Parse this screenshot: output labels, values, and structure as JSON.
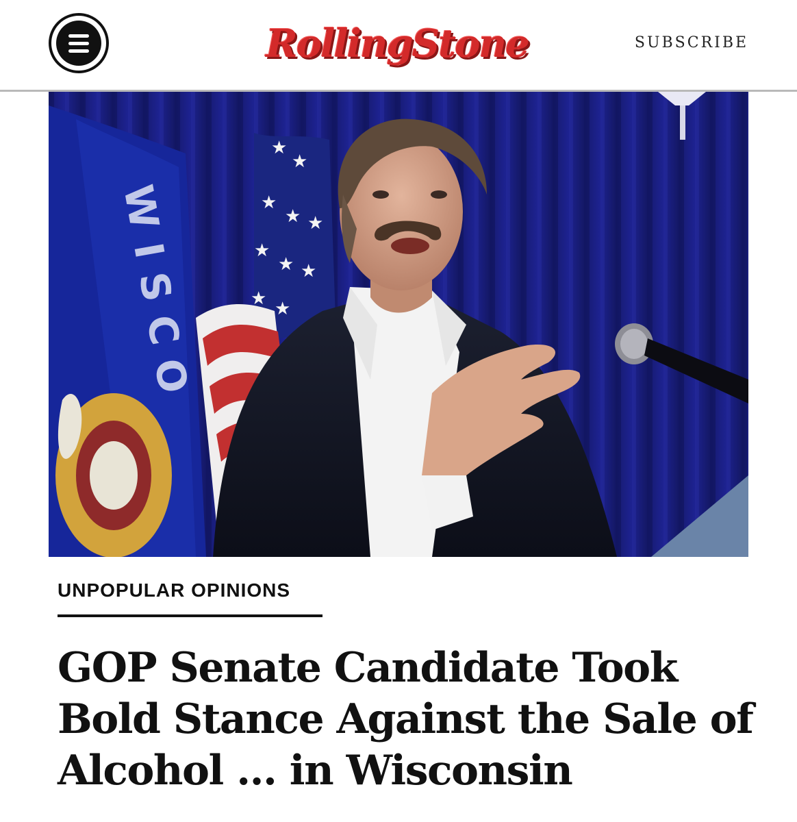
{
  "header": {
    "logo_text": "RollingStone",
    "subscribe_label": "SUBSCRIBE",
    "menu_icon": "hamburger-menu-icon",
    "brand_color": "#d32a2a"
  },
  "hero_image": {
    "flag_lettering": "WISCO"
  },
  "article": {
    "category": "UNPOPULAR OPINIONS",
    "headline_lines": [
      "GOP Senate Candidate Took",
      "Bold Stance Against the Sale of",
      "Alcohol ... in Wisconsin"
    ]
  }
}
